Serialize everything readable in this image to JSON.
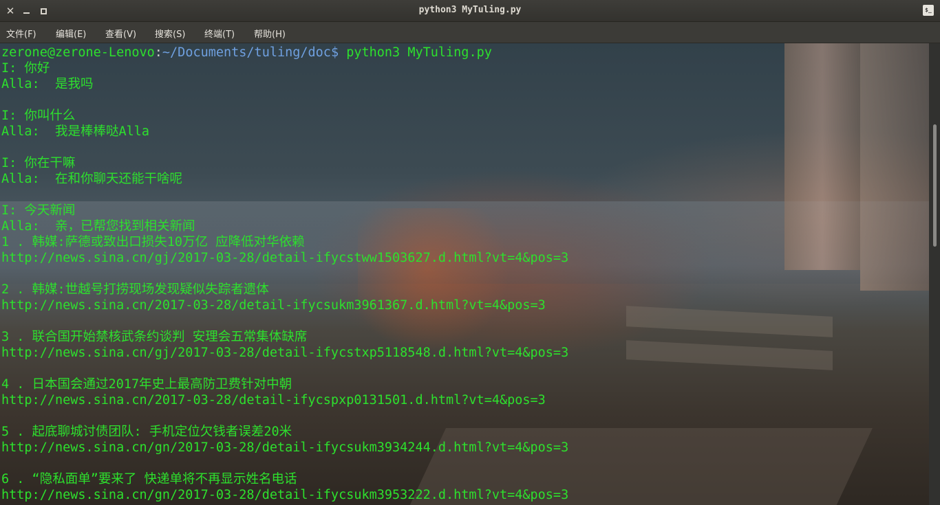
{
  "window": {
    "title": "python3 MyTuling.py",
    "close_glyph": "✕",
    "terminal_icon_text": "$_"
  },
  "menubar": {
    "items": [
      {
        "label": "文件(F)"
      },
      {
        "label": "编辑(E)"
      },
      {
        "label": "查看(V)"
      },
      {
        "label": "搜索(S)"
      },
      {
        "label": "终端(T)"
      },
      {
        "label": "帮助(H)"
      }
    ]
  },
  "terminal": {
    "prompt": {
      "user_host": "zerone@zerone-Lenovo",
      "colon": ":",
      "path": "~/Documents/tuling/doc",
      "suffix": "$ ",
      "command": "python3 MyTuling.py"
    },
    "lines": [
      "I: 你好",
      "Alla:  是我吗",
      "",
      "I: 你叫什么",
      "Alla:  我是棒棒哒Alla",
      "",
      "I: 你在干嘛",
      "Alla:  在和你聊天还能干啥呢",
      "",
      "I: 今天新闻",
      "Alla:  亲，已帮您找到相关新闻",
      "1 . 韩媒:萨德或致出口损失10万亿 应降低对华依赖",
      "http://news.sina.cn/gj/2017-03-28/detail-ifycstww1503627.d.html?vt=4&pos=3",
      "",
      "2 . 韩媒:世越号打捞现场发现疑似失踪者遗体",
      "http://news.sina.cn/2017-03-28/detail-ifycsukm3961367.d.html?vt=4&pos=3",
      "",
      "3 . 联合国开始禁核武条约谈判 安理会五常集体缺席",
      "http://news.sina.cn/gj/2017-03-28/detail-ifycstxp5118548.d.html?vt=4&pos=3",
      "",
      "4 . 日本国会通过2017年史上最高防卫费针对中朝",
      "http://news.sina.cn/2017-03-28/detail-ifycspxp0131501.d.html?vt=4&pos=3",
      "",
      "5 . 起底聊城讨债团队: 手机定位欠钱者误差20米",
      "http://news.sina.cn/gn/2017-03-28/detail-ifycsukm3934244.d.html?vt=4&pos=3",
      "",
      "6 . “隐私面单”要来了 快递单将不再显示姓名电话",
      "http://news.sina.cn/gn/2017-03-28/detail-ifycsukm3953222.d.html?vt=4&pos=3"
    ]
  },
  "colors": {
    "text": "#2de02d",
    "path": "#6fa0e0",
    "titlebar": "#3e3d39"
  }
}
